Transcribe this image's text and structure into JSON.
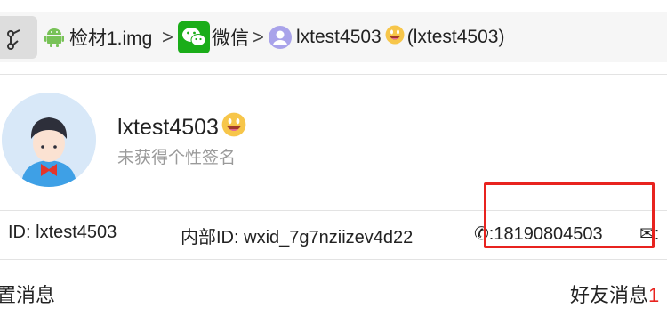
{
  "breadcrumb": {
    "items": [
      {
        "label": "检材1.img",
        "icon": "android-icon"
      },
      {
        "label": "微信",
        "icon": "wechat-icon"
      },
      {
        "label": "lxtest4503",
        "icon": "user-avatar-icon",
        "suffix": "(lxtest4503)"
      }
    ],
    "separator": ">"
  },
  "profile": {
    "name": "lxtest4503",
    "signature": "未获得个性签名"
  },
  "info": {
    "id_label": "ID:",
    "id_value": "lxtest4503",
    "internal_id_label": "内部ID:",
    "internal_id_value": "wxid_7g7nziizev4d22",
    "phone_value": ":18190804503",
    "email_value": ":"
  },
  "sections": {
    "left_label": "置消息",
    "right_label": "好友消息",
    "right_accent": "1"
  },
  "colors": {
    "highlight": "#e8231f",
    "wechat": "#1aad19",
    "android": "#78c257"
  }
}
